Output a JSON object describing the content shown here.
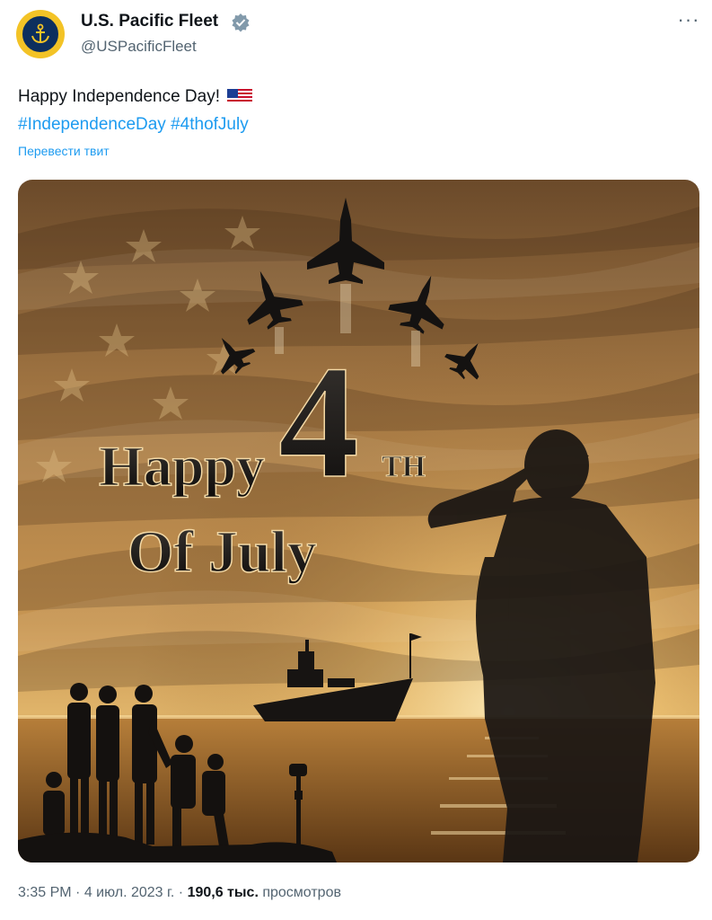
{
  "author": {
    "display_name": "U.S. Pacific Fleet",
    "handle": "@USPacificFleet",
    "verified": true,
    "avatar_icon": "anchor-icon"
  },
  "more_label": "···",
  "tweet": {
    "text": "Happy Independence Day!",
    "emoji": "us-flag-icon",
    "hashtags": [
      "#IndependenceDay",
      "#4thofJuly"
    ],
    "translate_label": "Перевести твит"
  },
  "image": {
    "headline_number": "4",
    "headline_suffix": "TH",
    "headline_word1": "Happy",
    "headline_word2": "Of July"
  },
  "meta": {
    "time": "3:35 PM",
    "separator1": " · ",
    "date": "4 июл. 2023 г.",
    "separator2": " · ",
    "views_count": "190,6 тыс.",
    "views_label": " просмотров"
  },
  "colors": {
    "link": "#1d9bf0",
    "secondary_text": "#536471",
    "primary_text": "#0f1419",
    "verified": "#829aab"
  }
}
